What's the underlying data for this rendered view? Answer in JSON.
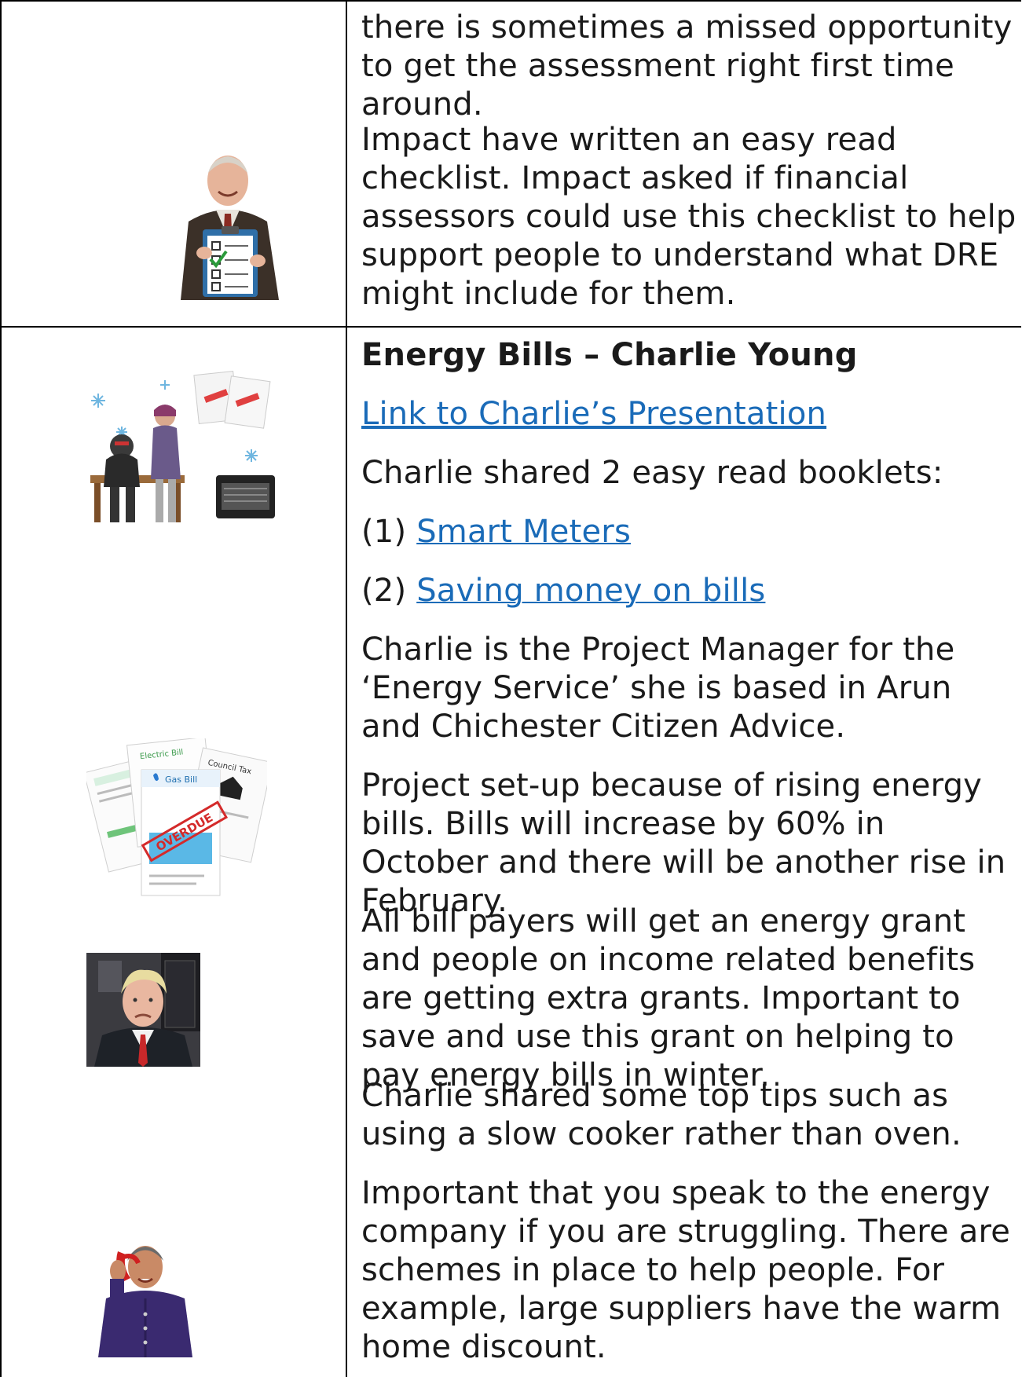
{
  "row1": {
    "para1": "there is sometimes a missed opportunity to get the assessment right first time around.",
    "para2": "Impact have written an easy read checklist. Impact asked if financial assessors could use this checklist to help support people to understand what DRE might include for them."
  },
  "row2": {
    "heading": "Energy Bills – Charlie Young",
    "presentation_link": "Link to Charlie’s Presentation",
    "booklets_intro": "Charlie shared 2 easy read booklets:",
    "booklet1_number": "(1) ",
    "booklet1_link": "Smart Meters",
    "booklet2_number": "(2) ",
    "booklet2_link": "Saving money on bills",
    "para_manager": "Charlie is the Project Manager for the ‘Energy Service’ she is based in Arun and Chichester Citizen Advice.",
    "para_project": "Project set-up because of rising energy bills. Bills will increase by 60% in October and there will be another rise in February.",
    "para_grant": "All bill payers will get an energy grant and people on income related benefits are getting extra grants. Important to save and use this grant on helping to pay energy bills in winter.",
    "para_tips": "Charlie shared some top tips such as using a slow cooker rather than oven.",
    "para_speak": "Important that you speak to the energy company if you are struggling. There are schemes in place to help people. For example, large suppliers have the warm home discount.",
    "bill_labels": {
      "electric": "Electric Bill",
      "council": "Council Tax",
      "gas": "Gas Bill",
      "overdue": "OVERDUE"
    }
  },
  "colors": {
    "link": "#1a6bb8",
    "text": "#1a1a1a",
    "border": "#000000"
  }
}
